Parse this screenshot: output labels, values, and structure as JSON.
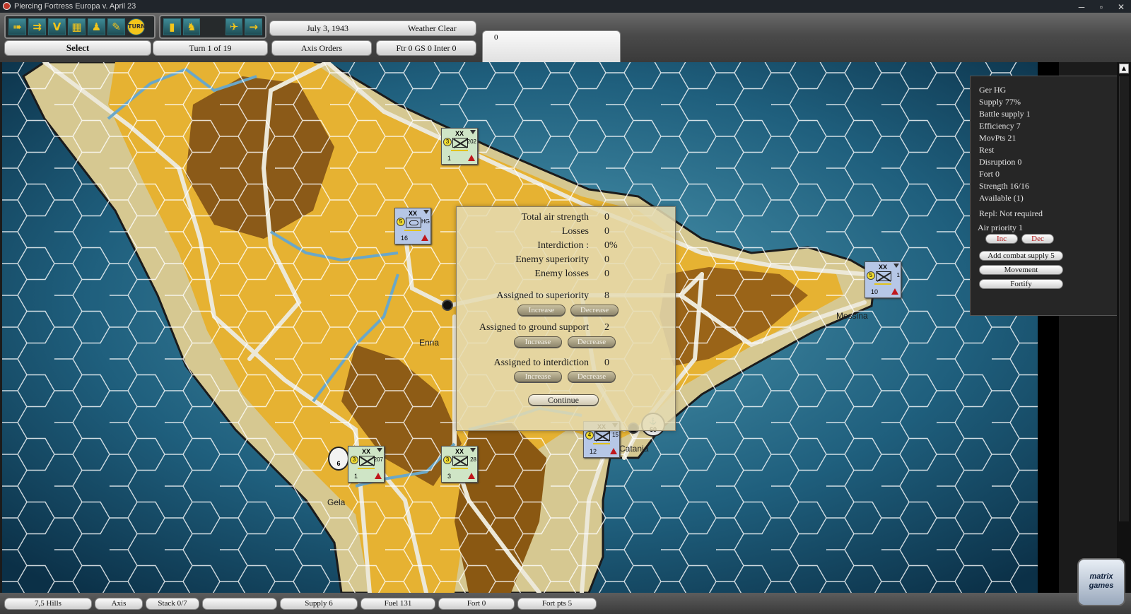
{
  "window": {
    "title": "Piercing Fortress Europa   v. April 23",
    "controls": [
      "─",
      "▫",
      "✕"
    ]
  },
  "toolbar": {
    "icons_left": [
      "move-all-icon",
      "move-stack-icon",
      "v-icon",
      "city-icon",
      "unit-icon",
      "orders-icon",
      "turn-icon"
    ],
    "icons_right": [
      "chart-icon",
      "soldiers-icon"
    ],
    "icons_air": [
      "aircraft-icon",
      "arrow-icon"
    ],
    "turn_icon_label": "TURN",
    "v_icon_label": "V",
    "date": "July 3, 1943",
    "weather": "Weather Clear",
    "select_label": "Select",
    "turn_label": "Turn 1 of 19",
    "orders_label": "Axis Orders",
    "air_status": "Ftr 0   GS 0   Inter 0",
    "message_value": "0"
  },
  "map": {
    "places": [
      "Enna",
      "Messina",
      "Catania",
      "Gela"
    ],
    "ports": [
      {
        "label": "60"
      },
      {
        "label": "6"
      }
    ],
    "units": [
      {
        "nation_color": "green",
        "size": "XX",
        "badge": "3",
        "id": "202",
        "strength": "1"
      },
      {
        "nation_color": "blue",
        "size": "XX",
        "badge": "5",
        "id": "HG",
        "strength": "16"
      },
      {
        "nation_color": "blue",
        "size": "XX",
        "badge": "5",
        "id": "1",
        "strength": "10"
      },
      {
        "nation_color": "blue",
        "size": "XX",
        "badge": "4",
        "id": "15",
        "strength": "12"
      },
      {
        "nation_color": "green",
        "size": "XX",
        "badge": "3",
        "id": "207",
        "strength": "1"
      },
      {
        "nation_color": "green",
        "size": "XX",
        "badge": "3",
        "id": "28",
        "strength": "3"
      }
    ],
    "colors": {
      "sea": "#0f3b56",
      "coast": "#d4c896",
      "plain": "#e8b431",
      "hill": "#8d5a14",
      "road": "#ece8d8",
      "river": "#6aa7c8"
    }
  },
  "air_dialog": {
    "stats": [
      {
        "label": "Total air strength",
        "value": "0"
      },
      {
        "label": "Losses",
        "value": "0"
      },
      {
        "label": "Interdiction :",
        "value": "0%"
      },
      {
        "label": "Enemy superiority",
        "value": "0"
      },
      {
        "label": "Enemy losses",
        "value": "0"
      }
    ],
    "assignments": [
      {
        "label": "Assigned to superiority",
        "value": "8",
        "increase": "Increase",
        "decrease": "Decrease"
      },
      {
        "label": "Assigned to ground support",
        "value": "2",
        "increase": "Increase",
        "decrease": "Decrease"
      },
      {
        "label": "Assigned to interdiction",
        "value": "0",
        "increase": "Increase",
        "decrease": "Decrease"
      }
    ],
    "continue_label": "Continue"
  },
  "unit_panel": {
    "name": "Ger HG",
    "lines": [
      "Supply  77%",
      "Battle supply 1",
      "Efficiency 7",
      "MovPts  21",
      "Rest",
      "Disruption  0",
      "Fort  0",
      "Strength  16/16",
      "Available (1)"
    ],
    "repl": "Repl: Not required",
    "air_priority": "Air priority 1",
    "inc_label": "Inc",
    "dec_label": "Dec",
    "add_supply_label": "Add combat supply 5",
    "movement_label": "Movement",
    "fortify_label": "Fortify"
  },
  "status_bar": {
    "hex": "7,5   Hills",
    "side": "Axis",
    "stack": "Stack 0/7",
    "blank": "",
    "supply": "Supply  6",
    "fuel": "Fuel  131",
    "fort": "Fort 0",
    "fort_pts": "Fort pts 5"
  },
  "logo_text": "matrix games"
}
